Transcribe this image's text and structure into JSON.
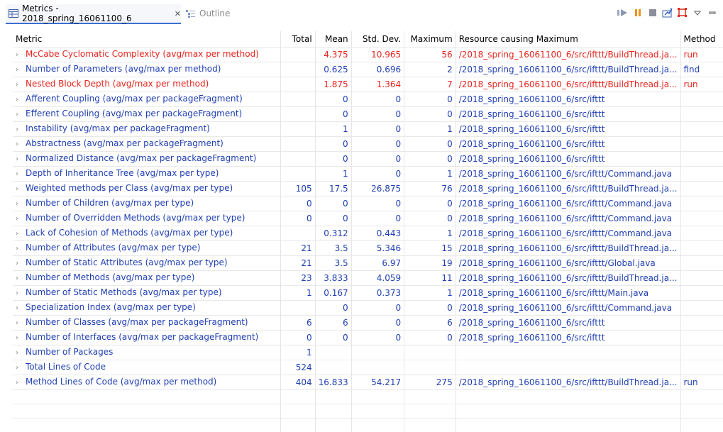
{
  "tabs": {
    "metrics_title": "Metrics - 2018_spring_16061100_6",
    "close": "✕",
    "outline_title": "Outline"
  },
  "toolbar": {
    "icons": [
      "play-icon",
      "pause-icon",
      "stop-icon",
      "export-icon",
      "layout-icon",
      "menu-icon",
      "minimize-icon"
    ]
  },
  "columns": [
    "Metric",
    "Total",
    "Mean",
    "Std. Dev.",
    "Maximum",
    "Resource causing Maximum",
    "Method"
  ],
  "rows": [
    {
      "metric": "McCabe Cyclomatic Complexity (avg/max per method)",
      "total": "",
      "mean": "4.375",
      "std": "10.965",
      "max": "56",
      "resource": "/2018_spring_16061100_6/src/ifttt/BuildThread.ja...",
      "method": "run",
      "style": "red"
    },
    {
      "metric": "Number of Parameters (avg/max per method)",
      "total": "",
      "mean": "0.625",
      "std": "0.696",
      "max": "2",
      "resource": "/2018_spring_16061100_6/src/ifttt/BuildThread.ja...",
      "method": "find",
      "style": "blue"
    },
    {
      "metric": "Nested Block Depth (avg/max per method)",
      "total": "",
      "mean": "1.875",
      "std": "1.364",
      "max": "7",
      "resource": "/2018_spring_16061100_6/src/ifttt/BuildThread.ja...",
      "method": "run",
      "style": "red"
    },
    {
      "metric": "Afferent Coupling (avg/max per packageFragment)",
      "total": "",
      "mean": "0",
      "std": "0",
      "max": "0",
      "resource": "/2018_spring_16061100_6/src/ifttt",
      "method": "",
      "style": "blue"
    },
    {
      "metric": "Efferent Coupling (avg/max per packageFragment)",
      "total": "",
      "mean": "0",
      "std": "0",
      "max": "0",
      "resource": "/2018_spring_16061100_6/src/ifttt",
      "method": "",
      "style": "blue"
    },
    {
      "metric": "Instability (avg/max per packageFragment)",
      "total": "",
      "mean": "1",
      "std": "0",
      "max": "1",
      "resource": "/2018_spring_16061100_6/src/ifttt",
      "method": "",
      "style": "blue"
    },
    {
      "metric": "Abstractness (avg/max per packageFragment)",
      "total": "",
      "mean": "0",
      "std": "0",
      "max": "0",
      "resource": "/2018_spring_16061100_6/src/ifttt",
      "method": "",
      "style": "blue"
    },
    {
      "metric": "Normalized Distance (avg/max per packageFragment)",
      "total": "",
      "mean": "0",
      "std": "0",
      "max": "0",
      "resource": "/2018_spring_16061100_6/src/ifttt",
      "method": "",
      "style": "blue"
    },
    {
      "metric": "Depth of Inheritance Tree (avg/max per type)",
      "total": "",
      "mean": "1",
      "std": "0",
      "max": "1",
      "resource": "/2018_spring_16061100_6/src/ifttt/Command.java",
      "method": "",
      "style": "blue"
    },
    {
      "metric": "Weighted methods per Class (avg/max per type)",
      "total": "105",
      "mean": "17.5",
      "std": "26.875",
      "max": "76",
      "resource": "/2018_spring_16061100_6/src/ifttt/BuildThread.ja...",
      "method": "",
      "style": "blue"
    },
    {
      "metric": "Number of Children (avg/max per type)",
      "total": "0",
      "mean": "0",
      "std": "0",
      "max": "0",
      "resource": "/2018_spring_16061100_6/src/ifttt/Command.java",
      "method": "",
      "style": "blue"
    },
    {
      "metric": "Number of Overridden Methods (avg/max per type)",
      "total": "0",
      "mean": "0",
      "std": "0",
      "max": "0",
      "resource": "/2018_spring_16061100_6/src/ifttt/Command.java",
      "method": "",
      "style": "blue"
    },
    {
      "metric": "Lack of Cohesion of Methods (avg/max per type)",
      "total": "",
      "mean": "0.312",
      "std": "0.443",
      "max": "1",
      "resource": "/2018_spring_16061100_6/src/ifttt/Command.java",
      "method": "",
      "style": "blue"
    },
    {
      "metric": "Number of Attributes (avg/max per type)",
      "total": "21",
      "mean": "3.5",
      "std": "5.346",
      "max": "15",
      "resource": "/2018_spring_16061100_6/src/ifttt/BuildThread.ja...",
      "method": "",
      "style": "blue"
    },
    {
      "metric": "Number of Static Attributes (avg/max per type)",
      "total": "21",
      "mean": "3.5",
      "std": "6.97",
      "max": "19",
      "resource": "/2018_spring_16061100_6/src/ifttt/Global.java",
      "method": "",
      "style": "blue"
    },
    {
      "metric": "Number of Methods (avg/max per type)",
      "total": "23",
      "mean": "3.833",
      "std": "4.059",
      "max": "11",
      "resource": "/2018_spring_16061100_6/src/ifttt/BuildThread.ja...",
      "method": "",
      "style": "blue"
    },
    {
      "metric": "Number of Static Methods (avg/max per type)",
      "total": "1",
      "mean": "0.167",
      "std": "0.373",
      "max": "1",
      "resource": "/2018_spring_16061100_6/src/ifttt/Main.java",
      "method": "",
      "style": "blue"
    },
    {
      "metric": "Specialization Index (avg/max per type)",
      "total": "",
      "mean": "0",
      "std": "0",
      "max": "0",
      "resource": "/2018_spring_16061100_6/src/ifttt/Command.java",
      "method": "",
      "style": "blue"
    },
    {
      "metric": "Number of Classes (avg/max per packageFragment)",
      "total": "6",
      "mean": "6",
      "std": "0",
      "max": "6",
      "resource": "/2018_spring_16061100_6/src/ifttt",
      "method": "",
      "style": "blue"
    },
    {
      "metric": "Number of Interfaces (avg/max per packageFragment)",
      "total": "0",
      "mean": "0",
      "std": "0",
      "max": "0",
      "resource": "/2018_spring_16061100_6/src/ifttt",
      "method": "",
      "style": "blue"
    },
    {
      "metric": "Number of Packages",
      "total": "1",
      "mean": "",
      "std": "",
      "max": "",
      "resource": "",
      "method": "",
      "style": "blue"
    },
    {
      "metric": "Total Lines of Code",
      "total": "524",
      "mean": "",
      "std": "",
      "max": "",
      "resource": "",
      "method": "",
      "style": "blue"
    },
    {
      "metric": "Method Lines of Code (avg/max per method)",
      "total": "404",
      "mean": "16.833",
      "std": "54.217",
      "max": "275",
      "resource": "/2018_spring_16061100_6/src/ifttt/BuildThread.ja...",
      "method": "run",
      "style": "blue"
    }
  ]
}
